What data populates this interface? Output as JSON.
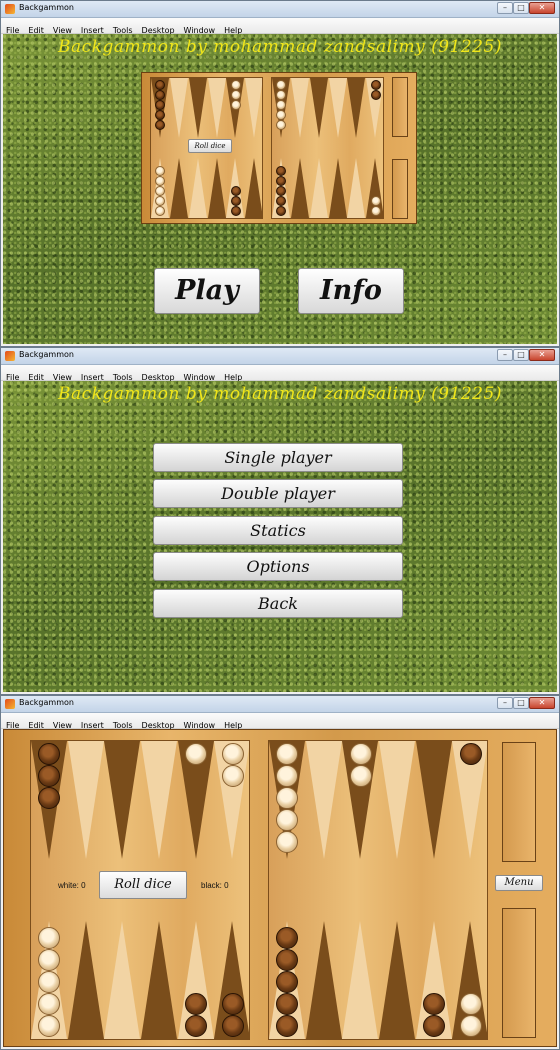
{
  "window": {
    "title": "Backgammon",
    "menus": [
      "File",
      "Edit",
      "View",
      "Insert",
      "Tools",
      "Desktop",
      "Window",
      "Help"
    ]
  },
  "screen1": {
    "heading": "Backgammon by mohammad zandsalimy (91225)",
    "preview_roll_label": "Roll dice",
    "play_label": "Play",
    "info_label": "Info"
  },
  "screen2": {
    "heading": "Backgammon by mohammad zandsalimy (91225)",
    "menu": [
      "Single player",
      "Double player",
      "Statics",
      "Options",
      "Back"
    ]
  },
  "screen3": {
    "roll_label": "Roll dice",
    "menu_label": "Menu",
    "white_score": "white: 0",
    "black_score": "black: 0"
  },
  "colors": {
    "heading": "#f0e61a",
    "dark_point": "#7a4d1b",
    "light_point": "#f2d4a4",
    "wood": "#e0aa60"
  }
}
